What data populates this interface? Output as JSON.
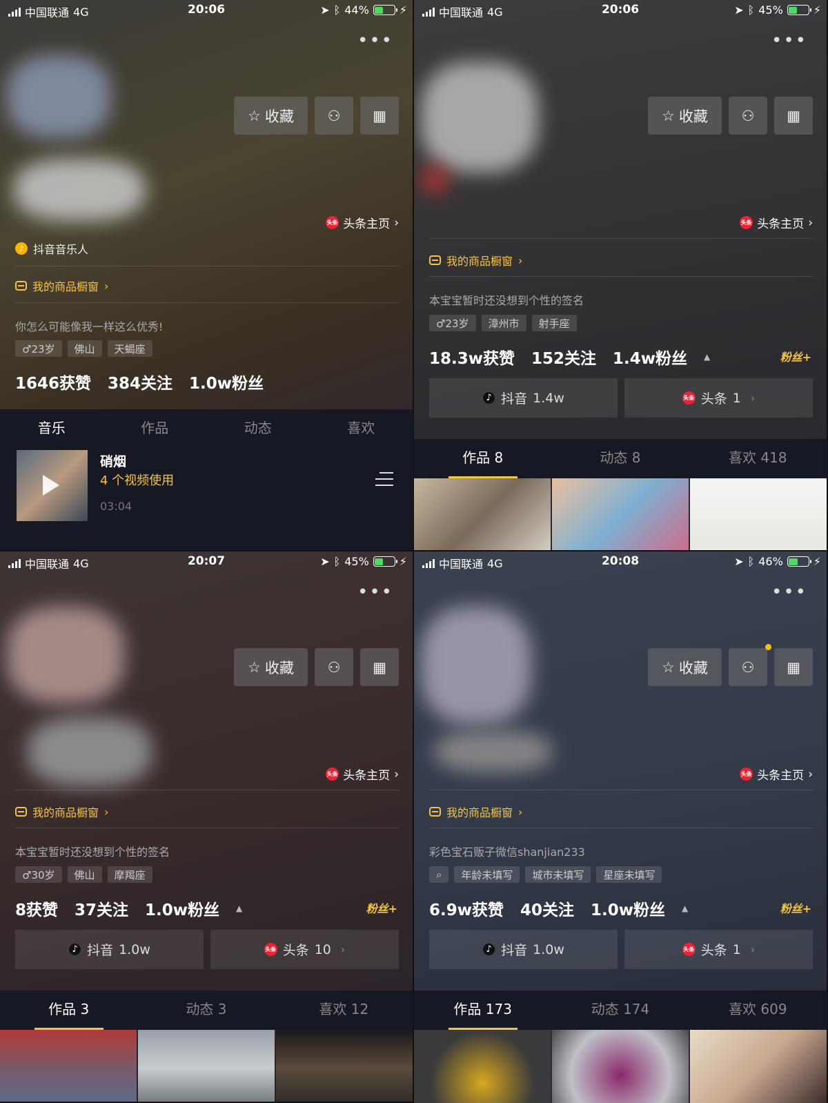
{
  "panels": [
    {
      "status": {
        "carrier": "中国联通",
        "network": "4G",
        "time": "20:06",
        "battery": "44%",
        "battery_level": 0.44
      },
      "more": "•••",
      "buttons": {
        "favorite": "收藏"
      },
      "toutiao_link": "头条主页",
      "music_tag": "抖音音乐人",
      "shop": "我的商品橱窗",
      "bio": "你怎么可能像我一样这么优秀!",
      "tags": [
        "♂23岁",
        "佛山",
        "天蝎座"
      ],
      "stats": {
        "likes": "1646获赞",
        "following": "384关注",
        "fans": "1.0w粉丝"
      },
      "tabs": [
        "音乐",
        "作品",
        "动态",
        "喜欢"
      ],
      "music": {
        "title": "硝烟",
        "uses": "4 个视频使用",
        "duration": "03:04"
      }
    },
    {
      "status": {
        "carrier": "中国联通",
        "network": "4G",
        "time": "20:06",
        "battery": "45%",
        "battery_level": 0.45
      },
      "more": "•••",
      "buttons": {
        "favorite": "收藏"
      },
      "toutiao_link": "头条主页",
      "shop": "我的商品橱窗",
      "bio": "本宝宝暂时还没想到个性的签名",
      "tags": [
        "♂23岁",
        "漳州市",
        "射手座"
      ],
      "stats": {
        "likes": "18.3w获赞",
        "following": "152关注",
        "fans": "1.4w粉丝"
      },
      "fans_badge": "粉丝+",
      "platforms": {
        "douyin_label": "抖音",
        "douyin_count": "1.4w",
        "toutiao_label": "头条",
        "toutiao_count": "1"
      },
      "tabs": [
        "作品 8",
        "动态 8",
        "喜欢 418"
      ]
    },
    {
      "status": {
        "carrier": "中国联通",
        "network": "4G",
        "time": "20:07",
        "battery": "45%",
        "battery_level": 0.45
      },
      "more": "•••",
      "buttons": {
        "favorite": "收藏"
      },
      "toutiao_link": "头条主页",
      "shop": "我的商品橱窗",
      "bio": "本宝宝暂时还没想到个性的签名",
      "tags": [
        "♂30岁",
        "佛山",
        "摩羯座"
      ],
      "stats": {
        "likes": "8获赞",
        "following": "37关注",
        "fans": "1.0w粉丝"
      },
      "fans_badge": "粉丝+",
      "platforms": {
        "douyin_label": "抖音",
        "douyin_count": "1.0w",
        "toutiao_label": "头条",
        "toutiao_count": "10"
      },
      "tabs": [
        "作品 3",
        "动态 3",
        "喜欢 12"
      ]
    },
    {
      "status": {
        "carrier": "中国联通",
        "network": "4G",
        "time": "20:08",
        "battery": "46%",
        "battery_level": 0.46
      },
      "more": "•••",
      "buttons": {
        "favorite": "收藏"
      },
      "toutiao_link": "头条主页",
      "shop": "我的商品橱窗",
      "bio": "彩色宝石贩子微信shanjian233",
      "tags": [
        "⌕",
        "年龄未填写",
        "城市未填写",
        "星座未填写"
      ],
      "stats": {
        "likes": "6.9w获赞",
        "following": "40关注",
        "fans": "1.0w粉丝"
      },
      "fans_badge": "粉丝+",
      "platforms": {
        "douyin_label": "抖音",
        "douyin_count": "1.0w",
        "toutiao_label": "头条",
        "toutiao_count": "1"
      },
      "tabs": [
        "作品 173",
        "动态 174",
        "喜欢 609"
      ]
    }
  ],
  "colors": {
    "accent": "#f6c344",
    "tab_bg": "#161823",
    "toutiao_red": "#e22233"
  }
}
